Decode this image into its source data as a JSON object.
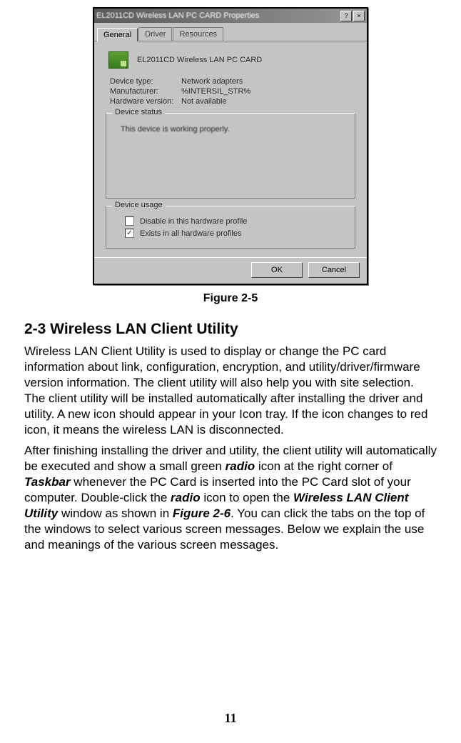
{
  "dialog": {
    "title": "EL2011CD Wireless LAN PC CARD Properties",
    "tabs": {
      "general": "General",
      "driver": "Driver",
      "resources": "Resources"
    },
    "device_name": "EL2011CD Wireless LAN PC CARD",
    "labels": {
      "device_type": "Device type:",
      "manufacturer": "Manufacturer:",
      "hardware_version": "Hardware version:"
    },
    "values": {
      "device_type": "Network adapters",
      "manufacturer": "%INTERSIL_STR%",
      "hardware_version": "Not available"
    },
    "status_group": "Device status",
    "status_text": "This device is working properly.",
    "usage_group": "Device usage",
    "usage_opts": {
      "disable": "Disable in this hardware profile",
      "exists": "Exists in all hardware profiles"
    },
    "ok": "OK",
    "cancel": "Cancel",
    "help_glyph": "?",
    "close_glyph": "×",
    "check_glyph": "✓"
  },
  "caption": "Figure 2-5",
  "heading": "2-3 Wireless LAN Client Utility",
  "p1": {
    "t1": "Wireless LAN Client Utility is used to display or change the PC card information about link, configuration, encryption, and utility/driver/firmware version information. The client utility will also help you with site selection. The client utility will be installed automatically after installing the driver and utility. A new icon should appear in your Icon tray. If the icon changes to red icon, it means the wireless LAN is disconnected."
  },
  "p2": {
    "s1": "After finishing installing the driver and utility, the client utility will automatically be executed and show a small green ",
    "b1": "radio",
    "s2": " icon at the right corner of ",
    "b2": "Taskbar",
    "s3": " whenever the PC Card is inserted into the PC Card slot of your computer. Double-click the ",
    "b3": "radio",
    "s4": " icon to open the ",
    "b4": "Wireless LAN Client Utility",
    "s5": " window as shown in ",
    "b5": "Figure 2-6",
    "s6": ". You can click the tabs on the top of the windows to select various screen messages. Below we explain the use and meanings of the various screen messages."
  },
  "page_number": "11"
}
